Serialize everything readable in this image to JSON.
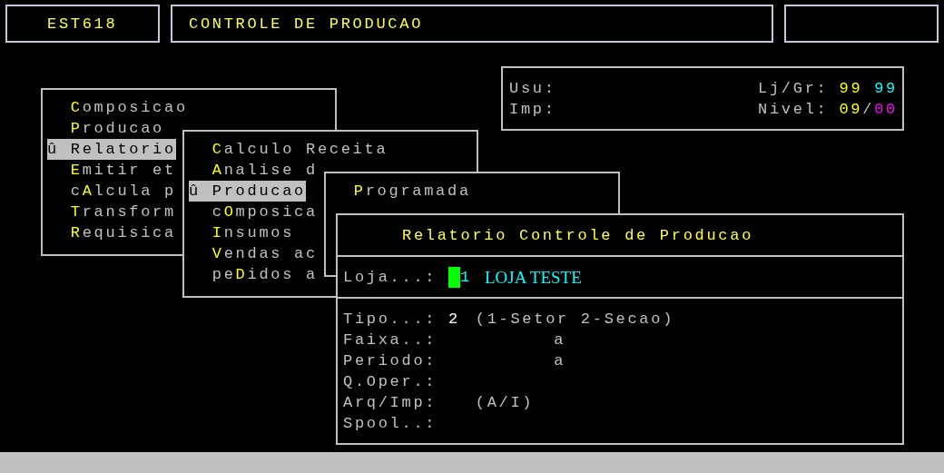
{
  "header": {
    "program_code": "EST618",
    "title": "CONTROLE DE PRODUCAO"
  },
  "info": {
    "left": [
      {
        "label": "Usu:"
      },
      {
        "label": "Imp:"
      }
    ],
    "right": [
      {
        "label": "Lj/Gr:",
        "spaced": true,
        "values": [
          {
            "text": "99",
            "color": "#ffff00"
          },
          {
            "text": "99",
            "color": "#00ffff"
          }
        ]
      },
      {
        "label": "Nivel:",
        "spaced": false,
        "values": [
          {
            "text": "09",
            "color": "#ffff00"
          },
          {
            "text": "/"
          },
          {
            "text": "00",
            "color": "#ff00ff"
          }
        ]
      }
    ]
  },
  "menus": [
    {
      "items": [
        {
          "hotkey": "C",
          "after": "omposicao",
          "selected": false
        },
        {
          "hotkey": "P",
          "after": "roducao",
          "selected": false
        },
        {
          "marker": "û",
          "after": "Relatorio",
          "selected": true
        },
        {
          "hotkey": "E",
          "after": "mitir et",
          "selected": false
        },
        {
          "before": "c",
          "hotkey": "A",
          "after": "lcula p",
          "selected": false
        },
        {
          "hotkey": "T",
          "after": "ransform",
          "selected": false
        },
        {
          "hotkey": "R",
          "after": "equisica",
          "selected": false
        }
      ]
    },
    {
      "items": [
        {
          "hotkey": "C",
          "after": "alculo Receita",
          "selected": false
        },
        {
          "hotkey": "A",
          "after": "nalise d",
          "selected": false
        },
        {
          "marker": "û",
          "after": "Producao",
          "selected": true
        },
        {
          "before": "c",
          "hotkey": "O",
          "after": "mposica",
          "selected": false
        },
        {
          "hotkey": "I",
          "after": "nsumos",
          "selected": false
        },
        {
          "hotkey": "V",
          "after": "endas ac",
          "selected": false
        },
        {
          "before": "pe",
          "hotkey": "D",
          "after": "idos a",
          "selected": false
        }
      ]
    },
    {
      "items": [
        {
          "hotkey": "P",
          "after": "rogramada",
          "selected": false
        }
      ]
    }
  ],
  "dialog": {
    "title": "Relatorio Controle de Producao",
    "store": {
      "label": "Loja...:",
      "code": "1",
      "name": "LOJA TESTE"
    },
    "fields": [
      {
        "kind": "choice",
        "label": "Tipo...:",
        "value": "2",
        "hint": "(1-Setor 2-Secao)"
      },
      {
        "kind": "range",
        "label": "Faixa..:",
        "separator": "a"
      },
      {
        "kind": "range",
        "label": "Periodo:",
        "separator": "a"
      },
      {
        "kind": "plain",
        "label": "Q.Oper.:"
      },
      {
        "kind": "choice",
        "label": "Arq/Imp:",
        "hint": "(A/I)"
      },
      {
        "kind": "plain",
        "label": "Spool..:"
      }
    ]
  }
}
